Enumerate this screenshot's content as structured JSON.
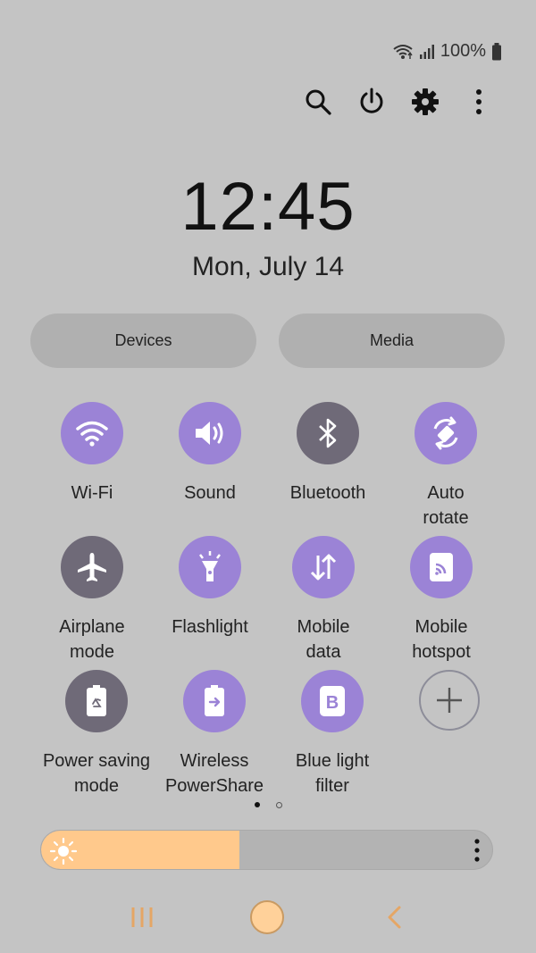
{
  "status": {
    "battery": "100%",
    "icons": [
      "wifi-icon",
      "signal-icon",
      "battery-icon"
    ]
  },
  "actions": [
    "search-icon",
    "power-icon",
    "settings-gear-icon",
    "more-vertical-icon"
  ],
  "clock": {
    "time": "12:45",
    "date": "Mon, July 14"
  },
  "buttons": {
    "devices": "Devices",
    "media": "Media"
  },
  "tiles": [
    {
      "label": "Wi-Fi",
      "state": "on",
      "icon": "wifi-icon"
    },
    {
      "label": "Sound",
      "state": "on",
      "icon": "speaker-icon"
    },
    {
      "label": "Bluetooth",
      "state": "off",
      "icon": "bluetooth-icon"
    },
    {
      "label": "Auto\nrotate",
      "state": "on",
      "icon": "auto-rotate-icon"
    },
    {
      "label": "Airplane\nmode",
      "state": "off",
      "icon": "airplane-icon"
    },
    {
      "label": "Flashlight",
      "state": "on",
      "icon": "flashlight-icon"
    },
    {
      "label": "Mobile\ndata",
      "state": "on",
      "icon": "mobile-data-icon"
    },
    {
      "label": "Mobile\nhotspot",
      "state": "on",
      "icon": "hotspot-icon"
    },
    {
      "label": "Power saving\nmode",
      "state": "off",
      "icon": "power-saving-icon"
    },
    {
      "label": "Wireless\nPowerShare",
      "state": "on",
      "icon": "wireless-powershare-icon"
    },
    {
      "label": "Blue light\nfilter",
      "state": "on",
      "icon": "blue-light-filter-icon"
    },
    {
      "label": "",
      "state": "add",
      "icon": "add-icon"
    }
  ],
  "pagination": {
    "current": 1,
    "total": 2
  },
  "brightness": {
    "level": 0.44
  },
  "colors": {
    "active": "#9b83d6",
    "inactive": "#6f6a78",
    "brightness": "#ffc98c",
    "background": "#c4c4c4"
  }
}
